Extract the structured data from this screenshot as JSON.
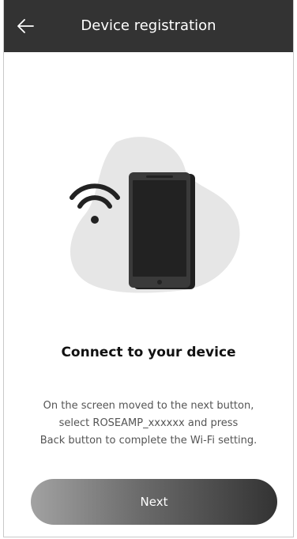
{
  "header": {
    "title": "Device registration",
    "back_icon": "arrow-left-icon"
  },
  "illustration": {
    "wifi_icon": "wifi-icon",
    "device_icon": "smartphone-icon"
  },
  "content": {
    "heading": "Connect to your device",
    "description_lines": [
      "On the screen moved to the next button,",
      "select ROSEAMP_xxxxxx and press",
      "Back button to complete the Wi-Fi setting."
    ]
  },
  "actions": {
    "next_label": "Next"
  },
  "colors": {
    "header_bg": "#333333",
    "blob": "#e6e6e6",
    "phone_body": "#2b2b2b"
  }
}
